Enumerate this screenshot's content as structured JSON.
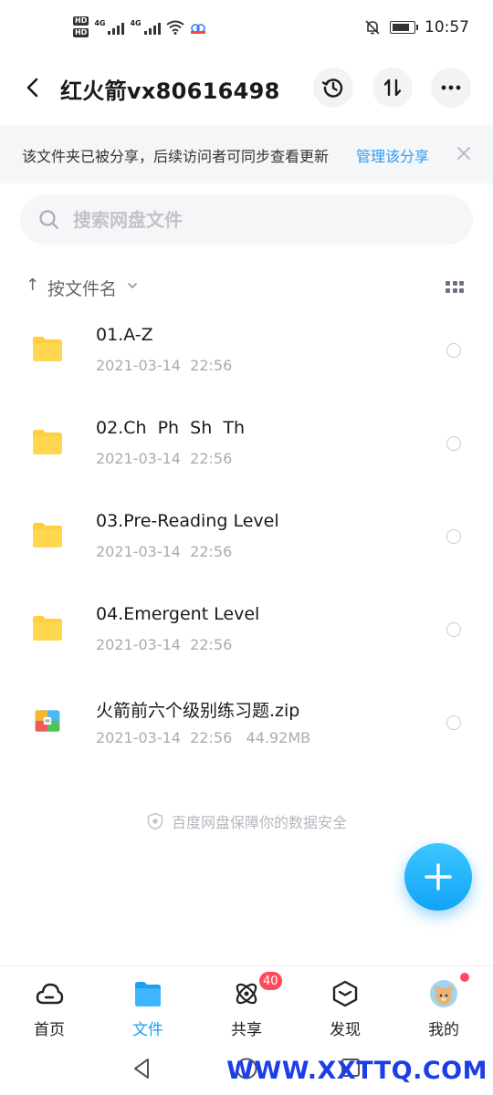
{
  "status_bar": {
    "hd1": "HD",
    "hd2": "HD",
    "net1": "4G",
    "net2": "4G",
    "time": "10:57"
  },
  "header": {
    "title": "红火箭vx80616498",
    "back_icon": "chevron-left-icon",
    "history_icon": "history-icon",
    "transfer_icon": "transfer-icon",
    "more_icon": "more-icon"
  },
  "share_banner": {
    "text": "该文件夹已被分享，后续访问者可同步查看更新",
    "link": "管理该分享",
    "link_color": "#2f9bf0"
  },
  "search": {
    "placeholder": "搜索网盘文件"
  },
  "sort": {
    "arrow": "↑",
    "label": "按文件名"
  },
  "files": [
    {
      "name": "01.A-Z",
      "meta": "2021-03-14  22:56",
      "type": "folder"
    },
    {
      "name": "02.Ch  Ph  Sh  Th",
      "meta": "2021-03-14  22:56",
      "type": "folder"
    },
    {
      "name": "03.Pre-Reading Level",
      "meta": "2021-03-14  22:56",
      "type": "folder"
    },
    {
      "name": "04.Emergent Level",
      "meta": "2021-03-14  22:56",
      "type": "folder"
    },
    {
      "name": "火箭前六个级别练习题.zip",
      "meta": "2021-03-14  22:56   44.92MB",
      "type": "zip"
    }
  ],
  "security_note": "百度网盘保障你的数据安全",
  "nav": {
    "items": [
      {
        "label": "首页",
        "icon": "cloud-icon"
      },
      {
        "label": "文件",
        "icon": "folder-icon",
        "active": true
      },
      {
        "label": "共享",
        "icon": "atom-icon"
      },
      {
        "label": "发现",
        "icon": "cube-icon"
      },
      {
        "label": "我的",
        "icon": "avatar"
      }
    ],
    "share_badge": "40",
    "active_color": "#1aa0f2"
  },
  "watermark": "WWW.XXTTQ.COM"
}
